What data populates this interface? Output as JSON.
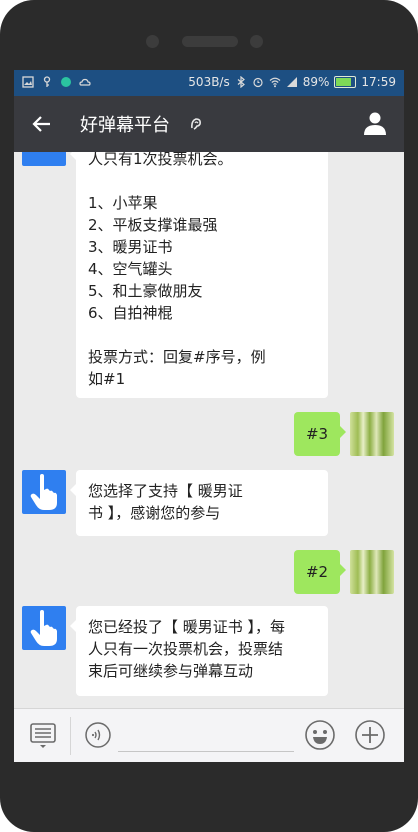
{
  "status_bar": {
    "speed": "503B/s",
    "battery": "89%",
    "time": "17:59"
  },
  "header": {
    "title": "好弹幕平台"
  },
  "messages": [
    {
      "lines": [
        "人只有1次投票机会。",
        "",
        "1、小苹果",
        "2、平板支撑谁最强",
        "3、暖男证书",
        "4、空气罐头",
        "5、和土豪做朋友",
        "6、自拍神棍",
        "",
        "投票方式：回复#序号，例",
        "如#1"
      ]
    },
    {
      "text": "#3"
    },
    {
      "lines": [
        "您选择了支持【 暖男证",
        "书 】，感谢您的参与"
      ]
    },
    {
      "text": "#2"
    },
    {
      "lines": [
        "您已经投了【 暖男证书 】，每",
        "人只有一次投票机会，投票结",
        "束后可继续参与弹幕互动"
      ]
    }
  ],
  "colors": {
    "status_bar_bg": "#1d4f82",
    "title_bar_bg": "#393a3f",
    "chat_bg": "#ebebeb",
    "sent_bubble": "#9ee75e",
    "bot_avatar": "#2f7ff0"
  },
  "icons": [
    "back-arrow-icon",
    "ear-icon",
    "profile-icon",
    "keyboard-icon",
    "voice-icon",
    "emoji-icon",
    "plus-icon",
    "hand-pointer-icon"
  ]
}
